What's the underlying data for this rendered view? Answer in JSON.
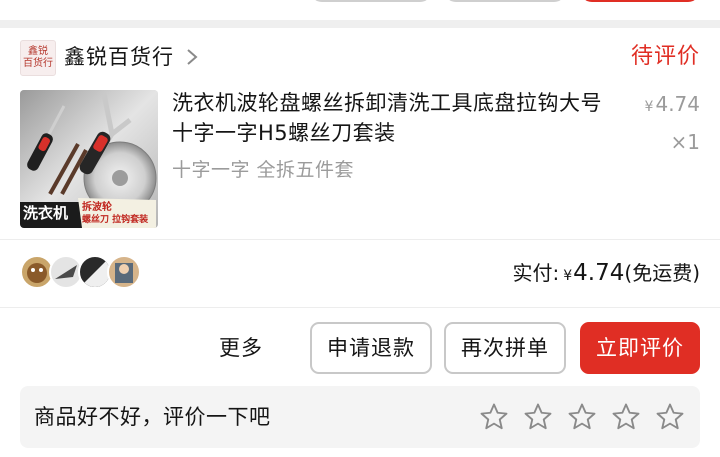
{
  "shop": {
    "logo_lines": [
      "鑫锐",
      "百货行"
    ],
    "name": "鑫锐百货行",
    "status": "待评价"
  },
  "product": {
    "title": "洗衣机波轮盘螺丝拆卸清洗工具底盘拉钩大号十字一字H5螺丝刀套装",
    "spec": "十字一字 全拆五件套",
    "price_currency": "¥",
    "price": "4.74",
    "quantity": "×1",
    "image_text": {
      "main": "洗衣机",
      "sub1": "拆波轮",
      "sub2": "螺丝刀 拉钩套装"
    }
  },
  "payment": {
    "label": "实付:",
    "currency": "¥",
    "amount": "4.74",
    "note": "(免运费)"
  },
  "actions": {
    "more": "更多",
    "refund": "申请退款",
    "rebuy": "再次拼单",
    "review": "立即评价"
  },
  "review_prompt": {
    "text": "商品好不好，评价一下吧",
    "star_count": 5
  },
  "colors": {
    "accent": "#e02e24",
    "muted_text": "#9b9b9b"
  }
}
